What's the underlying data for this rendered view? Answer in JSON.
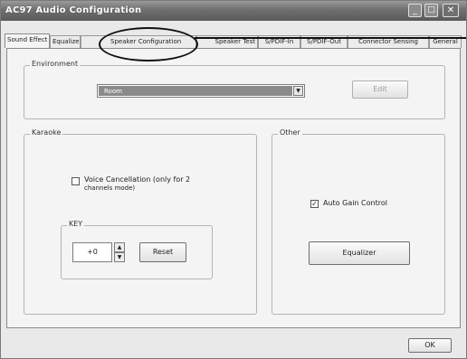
{
  "window": {
    "title": "AC97 Audio Configuration",
    "minimize_glyph": "_",
    "maximize_glyph": "□",
    "close_glyph": "✕"
  },
  "tabs": [
    {
      "label": "Sound Effect",
      "active": true
    },
    {
      "label": "Equalizer"
    },
    {
      "label": "Speaker Configuration"
    },
    {
      "label": "Speaker Test"
    },
    {
      "label": "S/PDIF-In"
    },
    {
      "label": "S/PDIF-Out"
    },
    {
      "label": "Connector Sensing"
    },
    {
      "label": "General"
    }
  ],
  "environment": {
    "label": "Environment",
    "selected": "Room",
    "arrow_glyph": "▼",
    "edit_button": "Edit"
  },
  "karaoke": {
    "label": "Karaoke",
    "voice_cancellation_line1": "Voice Cancellation (only for 2",
    "voice_cancellation_line2": "channels mode)",
    "key_label": "KEY",
    "key_value": "+0",
    "spin_up": "▲",
    "spin_down": "▼",
    "reset_button": "Reset"
  },
  "other": {
    "label": "Other",
    "auto_gain_label": "Auto Gain Control",
    "auto_gain_check": "✓",
    "equalizer_button": "Equalizer"
  },
  "footer": {
    "ok_button": "OK"
  }
}
